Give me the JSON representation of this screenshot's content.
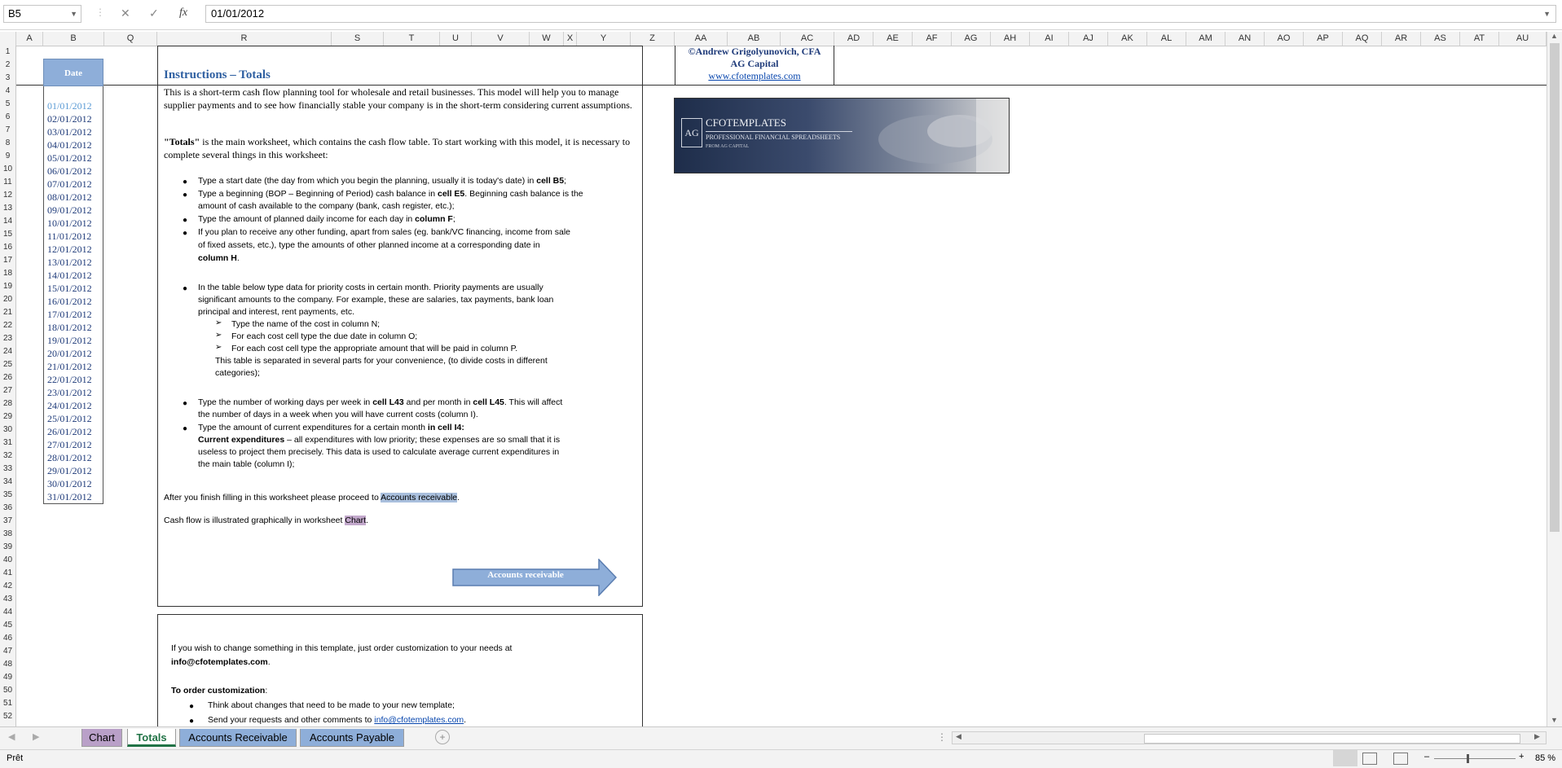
{
  "formula_bar": {
    "name_box": "B5",
    "cancel_icon": "✕",
    "enter_icon": "✓",
    "fx_label": "fx",
    "value": "01/01/2012"
  },
  "columns": [
    "A",
    "B",
    "Q",
    "R",
    "S",
    "T",
    "U",
    "V",
    "W",
    "X",
    "Y",
    "Z",
    "AA",
    "AB",
    "AC",
    "AD",
    "AE",
    "AF",
    "AG",
    "AH",
    "AI",
    "AJ",
    "AK",
    "AL",
    "AM",
    "AN",
    "AO",
    "AP",
    "AQ",
    "AR",
    "AS",
    "AT",
    "AU"
  ],
  "rows": [
    "1",
    "2",
    "3",
    "4",
    "5",
    "6",
    "7",
    "8",
    "9",
    "10",
    "11",
    "12",
    "13",
    "14",
    "15",
    "16",
    "17",
    "18",
    "19",
    "20",
    "21",
    "22",
    "23",
    "24",
    "25",
    "26",
    "27",
    "28",
    "29",
    "30",
    "31",
    "32",
    "33",
    "34",
    "35",
    "36",
    "37",
    "38",
    "39",
    "40",
    "41",
    "42",
    "43",
    "44",
    "45",
    "46",
    "47",
    "48",
    "49",
    "50",
    "51",
    "52"
  ],
  "date_column": {
    "header": "Date",
    "dates": [
      "01/01/2012",
      "02/01/2012",
      "03/01/2012",
      "04/01/2012",
      "05/01/2012",
      "06/01/2012",
      "07/01/2012",
      "08/01/2012",
      "09/01/2012",
      "10/01/2012",
      "11/01/2012",
      "12/01/2012",
      "13/01/2012",
      "14/01/2012",
      "15/01/2012",
      "16/01/2012",
      "17/01/2012",
      "18/01/2012",
      "19/01/2012",
      "20/01/2012",
      "21/01/2012",
      "22/01/2012",
      "23/01/2012",
      "24/01/2012",
      "25/01/2012",
      "26/01/2012",
      "27/01/2012",
      "28/01/2012",
      "29/01/2012",
      "30/01/2012",
      "31/01/2012"
    ]
  },
  "instructions": {
    "title": "Instructions – Totals",
    "intro": "This is a short-term cash flow planning tool for wholesale and retail businesses. This model will help you to manage supplier payments and to see how financially stable your company is in the short-term considering current assumptions.",
    "totals_bold": "\"Totals\"",
    "totals_rest": " is the main worksheet, which contains the cash flow table. To start working with this model, it is necessary to complete several things in this worksheet:",
    "b1_a": "Type a start date (the day from which you begin the planning, usually it is today's date) in ",
    "b1_b": "cell B5",
    "b1_c": ";",
    "b2_a": "Type a beginning (BOP – Beginning of Period) cash balance in ",
    "b2_b": "cell E5",
    "b2_c": ". Beginning cash balance is the",
    "b2_d": "amount of cash available to the company (bank, cash register, etc.);",
    "b3_a": "Type the amount of planned daily income for each day in ",
    "b3_b": "column F",
    "b3_c": ";",
    "b4_a": "If you plan to receive any other funding, apart from sales (eg. bank/VC financing, income from sale",
    "b4_b": "of fixed assets, etc.), type the amounts of other planned income at a corresponding date in",
    "b4_c": "column H",
    "b4_d": ".",
    "b5_a": "In the table below type data for priority costs in certain month. Priority payments are usually",
    "b5_b": "significant amounts to the company. For example, these are salaries, tax payments, bank loan",
    "b5_c": "principal and interest, rent payments, etc.",
    "s1": "Type the name of the cost in column N;",
    "s2": "For each cost cell type the due date in column O;",
    "s3": "For each cost cell type the appropriate amount that will be paid in column P.",
    "s4_a": "This table is separated in several parts for your convenience, (to divide costs in different",
    "s4_b": "categories);",
    "b6_a": "Type the number of working days per week in ",
    "b6_b": "cell L43",
    "b6_c": " and per month in ",
    "b6_d": "cell L45",
    "b6_e": ". This will affect",
    "b6_f": "the number of days in a week when you will have current costs (column I).",
    "b7_a": "Type the amount of current expenditures for a certain month ",
    "b7_b": "in cell I4:",
    "b7_c": "Current expenditures",
    "b7_d": " – all expenditures with low priority; these expenses are so small that it is",
    "b7_e": "useless to project them precisely. This data is used to calculate average current expenditures in",
    "b7_f": "the main table (column I);",
    "after_a": "After you finish filling in this worksheet please proceed to ",
    "after_link": "Accounts receivable",
    "after_c": ".",
    "chart_a": "Cash flow is illustrated graphically in worksheet ",
    "chart_link": "Chart",
    "chart_c": ".",
    "arrow_button": "Accounts receivable"
  },
  "custom_box": {
    "line1": "If you wish to change something in this template, just order customization to your needs at",
    "email": "info@cfotemplates.com",
    "email_dot": ".",
    "order_title": "To order customization",
    "order_colon": ":",
    "c1": "Think about changes that need to be made to your new template;",
    "c2_a": "Send your requests and other comments to ",
    "c2_link": "info@cfotemplates.com",
    "c2_dot": "."
  },
  "author": {
    "line1": "©Andrew Grigolyunovich, CFA",
    "line2": "AG Capital",
    "link": "www.cfotemplates.com"
  },
  "logo": {
    "monogram": "AG",
    "name": "CFOTEMPLATES",
    "tagline": "PROFESSIONAL FINANCIAL SPREADSHEETS",
    "sub": "FROM AG CAPITAL"
  },
  "tabs": [
    {
      "label": "Chart",
      "color": "#b9a0c8"
    },
    {
      "label": "Totals",
      "color": "#ffffff"
    },
    {
      "label": "Accounts Receivable",
      "color": "#8eaed9"
    },
    {
      "label": "Accounts Payable",
      "color": "#8eaed9"
    }
  ],
  "status": {
    "ready": "Prêt",
    "zoom": "85 %",
    "minus": "–",
    "plus": "+"
  },
  "colors": {
    "accent_blue": "#8eaed9",
    "title_blue": "#2e5fa1",
    "date_text": "#1f3b7a",
    "active_tab_text": "#217346"
  }
}
